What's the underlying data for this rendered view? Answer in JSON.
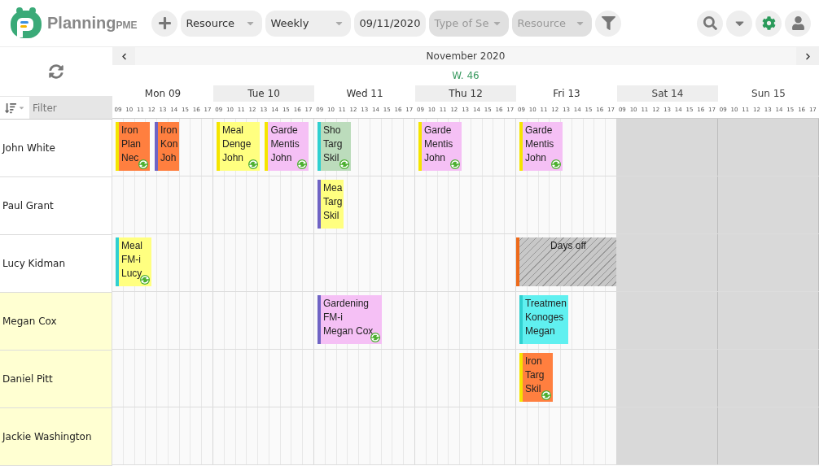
{
  "app": {
    "logo_text": "Planning",
    "logo_suffix": "PME"
  },
  "toolbar": {
    "selects": [
      {
        "value": "Resource",
        "disabled": false
      },
      {
        "value": "Weekly",
        "disabled": false
      }
    ],
    "date": "09/11/2020",
    "filters": [
      {
        "placeholder": "Type of Se"
      },
      {
        "placeholder": "Resource"
      }
    ]
  },
  "calendar": {
    "month": "November 2020",
    "week": "W. 46",
    "filter_placeholder": "Filter",
    "days": [
      {
        "label": "Mon 09",
        "weekend": false,
        "hours": [
          "09",
          "10",
          "11",
          "12",
          "13",
          "14",
          "15",
          "16",
          "17"
        ]
      },
      {
        "label": "Tue 10",
        "weekend": false,
        "hours": [
          "09",
          "10",
          "11",
          "12",
          "13",
          "14",
          "15",
          "16",
          "17"
        ]
      },
      {
        "label": "Wed 11",
        "weekend": false,
        "hours": [
          "09",
          "10",
          "11",
          "12",
          "13",
          "14",
          "15",
          "16",
          "17"
        ]
      },
      {
        "label": "Thu 12",
        "weekend": false,
        "hours": [
          "09",
          "10",
          "11",
          "12",
          "13",
          "14",
          "15",
          "16",
          "17"
        ]
      },
      {
        "label": "Fri 13",
        "weekend": false,
        "hours": [
          "09",
          "10",
          "11",
          "12",
          "13",
          "14",
          "15",
          "16",
          "17"
        ]
      },
      {
        "label": "Sat 14",
        "weekend": true,
        "hours": [
          "09",
          "10",
          "11",
          "12",
          "13",
          "14",
          "15",
          "16",
          "17"
        ]
      },
      {
        "label": "Sun 15",
        "weekend": true,
        "hours": [
          "09",
          "10",
          "11",
          "12",
          "13",
          "14",
          "15",
          "16",
          "17"
        ]
      }
    ],
    "rows": [
      {
        "name": "John White",
        "highlighted": false,
        "cells": [
          {
            "events": [
              {
                "kind": "task",
                "color": "#ff7f3f",
                "tag": {
                  "color": "#f5e500"
                },
                "lines": [
                  "Iron",
                  "Plan",
                  "Nec"
                ],
                "recurring": true
              },
              {
                "kind": "task",
                "color": "#ff7f3f",
                "tag": {
                  "color": "#6f63c4"
                },
                "lines": [
                  "Iron",
                  "Kon",
                  "Joh"
                ],
                "recurring": false
              }
            ]
          },
          {
            "events": [
              {
                "kind": "task",
                "color": "#ffff80",
                "tag": {
                  "color": "#f5e500"
                },
                "lines": [
                  "Meal",
                  "Denge",
                  "John"
                ],
                "recurring": true
              },
              {
                "kind": "task",
                "color": "#f5c0f5",
                "tag": {
                  "color": "#f5e500"
                },
                "lines": [
                  "Garde",
                  "Mentis",
                  "John"
                ],
                "recurring": true
              }
            ]
          },
          {
            "events": [
              {
                "kind": "task",
                "color": "#bcdcbc",
                "tag": {
                  "color": "#30d0d0"
                },
                "lines": [
                  "Sho",
                  "Targ",
                  "Skil"
                ],
                "recurring": true
              }
            ]
          },
          {
            "events": [
              {
                "kind": "task",
                "color": "#f5c0f5",
                "tag": {
                  "color": "#f5e500"
                },
                "lines": [
                  "Garde",
                  "Mentis",
                  "John"
                ],
                "recurring": true
              }
            ]
          },
          {
            "events": [
              {
                "kind": "task",
                "color": "#f5c0f5",
                "tag": {
                  "color": "#f5e500"
                },
                "lines": [
                  "Garde",
                  "Mentis",
                  "John"
                ],
                "recurring": true
              }
            ]
          },
          {},
          {}
        ]
      },
      {
        "name": "Paul Grant",
        "highlighted": false,
        "cells": [
          {},
          {},
          {
            "events": [
              {
                "kind": "task",
                "color": "#ffff80",
                "tag": {
                  "color": "#6f63c4"
                },
                "lines": [
                  "Mea",
                  "Targ",
                  "Skil"
                ],
                "recurring": false
              }
            ]
          },
          {},
          {},
          {},
          {}
        ]
      },
      {
        "name": "Lucy Kidman",
        "highlighted": false,
        "cells": [
          {
            "events": [
              {
                "kind": "task",
                "color": "#ffff80",
                "tag": {
                  "color": "#30d0d0"
                },
                "lines": [
                  "Meal",
                  "FM-i",
                  "Lucy"
                ],
                "recurring": true
              }
            ]
          },
          {},
          {},
          {},
          {
            "events": [
              {
                "kind": "absence",
                "color": "#c8c8c8",
                "tag": {
                  "color": "#ee6a1a"
                },
                "lines": [
                  "Days off"
                ],
                "recurring": false
              }
            ]
          },
          {},
          {}
        ]
      },
      {
        "name": "Megan Cox",
        "highlighted": true,
        "cells": [
          {},
          {},
          {
            "events": [
              {
                "kind": "task",
                "color": "#f5c0f5",
                "tag": {
                  "color": "#6f63c4"
                },
                "lines": [
                  "Gardening",
                  "FM-i",
                  "Megan Cox"
                ],
                "recurring": true
              }
            ]
          },
          {},
          {
            "events": [
              {
                "kind": "task",
                "color": "#60f0f0",
                "tag": {
                  "color": "#30d0d0"
                },
                "lines": [
                  "Treatmen",
                  "Konoges",
                  "Megan"
                ],
                "recurring": false
              }
            ]
          },
          {},
          {}
        ]
      },
      {
        "name": "Daniel Pitt",
        "highlighted": true,
        "cells": [
          {},
          {},
          {},
          {},
          {
            "events": [
              {
                "kind": "task",
                "color": "#ff7f3f",
                "tag": {
                  "color": "#f5e500"
                },
                "lines": [
                  "Iron",
                  "Targ",
                  "Skil"
                ],
                "recurring": true
              }
            ]
          },
          {},
          {}
        ]
      },
      {
        "name": "Jackie Washington",
        "highlighted": true,
        "cells": [
          {},
          {},
          {},
          {},
          {},
          {},
          {}
        ]
      }
    ]
  }
}
